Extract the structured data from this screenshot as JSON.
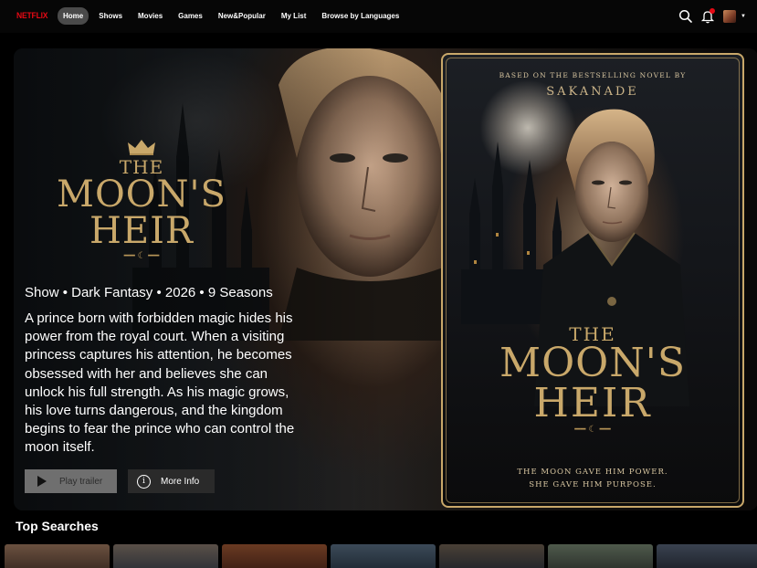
{
  "nav": {
    "logo": "NETFLIX",
    "links": [
      "Home",
      "Shows",
      "Movies",
      "Games",
      "New&Popular",
      "My List",
      "Browse by Languages"
    ],
    "active_index": 0,
    "icons": [
      "search-icon",
      "bell-icon",
      "avatar",
      "caret-down-icon"
    ]
  },
  "hero": {
    "title": {
      "the": "THE",
      "moon": "MOON'S",
      "heir": "HEIR"
    },
    "meta": "Show • Dark Fantasy • 2026 • 9 Seasons",
    "synopsis": "A prince born with forbidden magic hides his power from the royal court. When a visiting princess captures his attention, he becomes obsessed with her and believes she can unlock his full strength. As his magic grows, his love turns dangerous, and the kingdom begins to fear the prince who can control the moon itself.",
    "buttons": {
      "trailer": "Play trailer",
      "info": "More Info"
    }
  },
  "poster": {
    "tag": "BASED ON THE BESTSELLING NOVEL BY",
    "author": "SAKANADE",
    "title": {
      "the": "THE",
      "moon": "MOON'S",
      "heir": "HEIR"
    },
    "tagline_1": "THE MOON GAVE HIM POWER.",
    "tagline_2": "SHE GAVE HIM PURPOSE."
  },
  "top_searches": {
    "title": "Top Searches",
    "thumbs": [
      {
        "colors": [
          "#3a2a22",
          "#6b5140"
        ]
      },
      {
        "colors": [
          "#2b2f36",
          "#5a5048"
        ]
      },
      {
        "colors": [
          "#3b1e14",
          "#6a3a22"
        ]
      },
      {
        "colors": [
          "#1e2832",
          "#3c4a58"
        ]
      },
      {
        "colors": [
          "#20242a",
          "#4a4036"
        ]
      },
      {
        "colors": [
          "#2a2f2a",
          "#4f5a4c"
        ]
      },
      {
        "colors": [
          "#1c2028",
          "#3a4250"
        ]
      }
    ]
  },
  "colors": {
    "brand": "#e50914",
    "gold": "#c9a86a",
    "bg": "#000000"
  }
}
